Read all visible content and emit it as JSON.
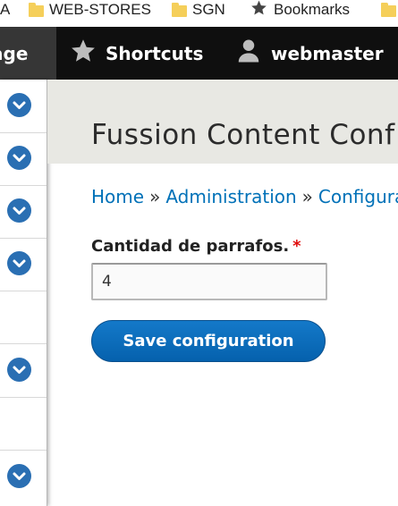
{
  "bookmarks_bar": {
    "items": [
      {
        "label": "A"
      },
      {
        "label": "WEB-STORES"
      },
      {
        "label": "SGN"
      },
      {
        "label": "Bookmarks"
      }
    ]
  },
  "toolbar": {
    "manage_label": "age",
    "shortcuts_label": "Shortcuts",
    "user_label": "webmaster"
  },
  "sidebar": {
    "rows": [
      {
        "expandable": true
      },
      {
        "expandable": true
      },
      {
        "expandable": true
      },
      {
        "expandable": true
      },
      {
        "expandable": false
      },
      {
        "expandable": true
      },
      {
        "expandable": false
      },
      {
        "expandable": true
      }
    ]
  },
  "page": {
    "title": "Fussion Content Conf"
  },
  "breadcrumb": {
    "items": [
      "Home",
      "Administration",
      "Configurat"
    ],
    "separator": "»"
  },
  "form": {
    "field_label": "Cantidad de parrafos.",
    "required_marker": "*",
    "field_value": "4",
    "save_label": "Save configuration"
  },
  "colors": {
    "toolbar_bg": "#0f0f0f",
    "accent": "#0071b8",
    "button": "#0b6fc1",
    "required": "#e00b0b"
  }
}
